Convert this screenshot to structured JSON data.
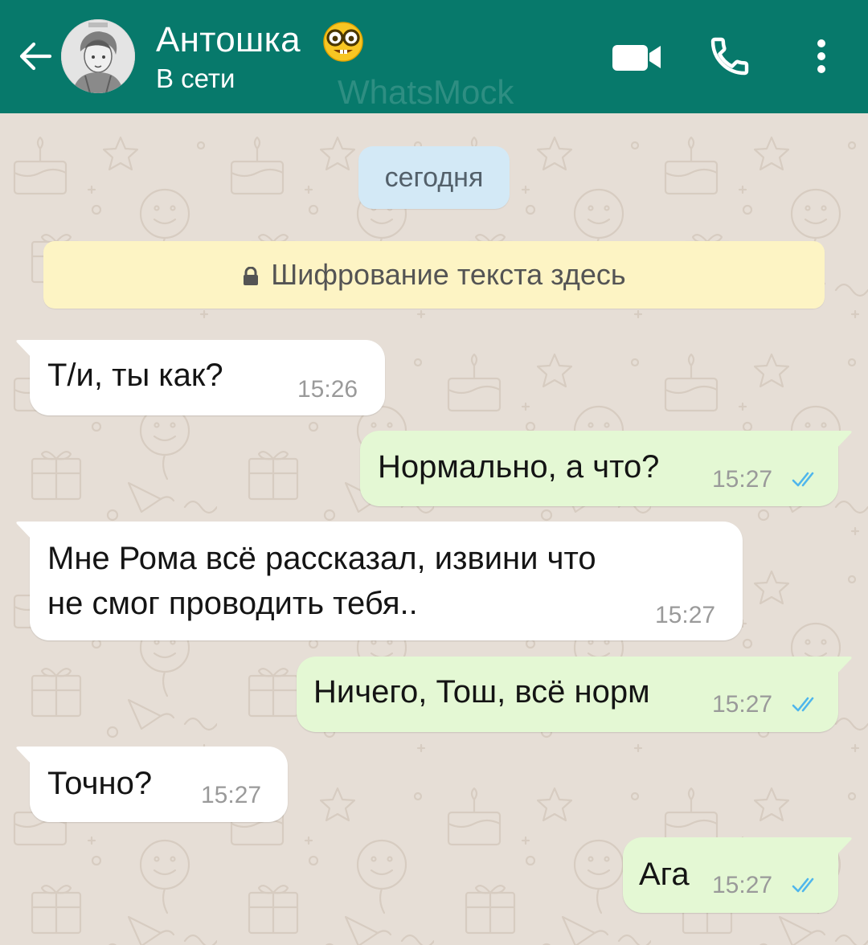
{
  "header": {
    "contact_name": "Антошка",
    "status": "В сети",
    "watermark": "WhatsMock",
    "name_emoji": "nerd-face-emoji",
    "icons": {
      "back": "arrow-left-icon",
      "video": "video-camera-icon",
      "call": "phone-icon",
      "menu": "more-vertical-icon"
    },
    "colors": {
      "header_bg": "#07796b",
      "header_text": "#ffffff"
    }
  },
  "chat": {
    "date_chip": "сегодня",
    "encryption_notice": "Шифрование текста здесь",
    "colors": {
      "wallpaper": "#e6ded6",
      "incoming_bubble": "#ffffff",
      "outgoing_bubble": "#e4f8d4",
      "read_ticks": "#4fb6ec",
      "notice_bg": "#fdf4c4",
      "date_chip_bg": "#d3e9f6"
    },
    "messages": [
      {
        "direction": "incoming",
        "lines": [
          "Т/и, ты как?"
        ],
        "time": "15:26"
      },
      {
        "direction": "outgoing",
        "lines": [
          "Нормально, а что?"
        ],
        "time": "15:27",
        "status": "read"
      },
      {
        "direction": "incoming",
        "lines": [
          "Мне Рома всё рассказал, извини что",
          "не смог проводить тебя.."
        ],
        "time": "15:27"
      },
      {
        "direction": "outgoing",
        "lines": [
          "Ничего, Тош, всё норм"
        ],
        "time": "15:27",
        "status": "read"
      },
      {
        "direction": "incoming",
        "lines": [
          "Точно?"
        ],
        "time": "15:27"
      },
      {
        "direction": "outgoing",
        "lines": [
          "Ага"
        ],
        "time": "15:27",
        "status": "read"
      }
    ]
  }
}
